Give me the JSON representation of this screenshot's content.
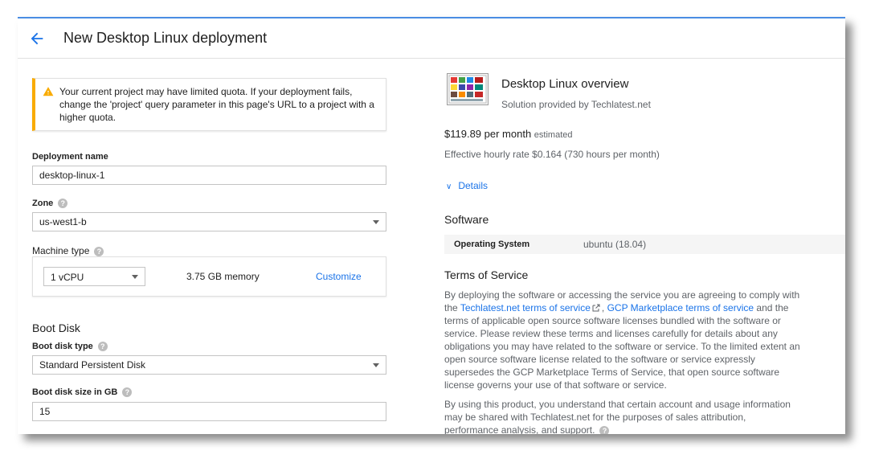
{
  "header": {
    "title": "New Desktop Linux deployment"
  },
  "alert": {
    "message": "Your current project may have limited quota. If your deployment fails, change the 'project' query parameter in this page's URL to a project with a higher quota."
  },
  "form": {
    "deployment_name_label": "Deployment name",
    "deployment_name_value": "desktop-linux-1",
    "zone_label": "Zone",
    "zone_value": "us-west1-b",
    "machine_type_label": "Machine type",
    "vcpu_value": "1 vCPU",
    "memory_text": "3.75 GB memory",
    "customize_label": "Customize",
    "boot_disk_title": "Boot Disk",
    "boot_disk_type_label": "Boot disk type",
    "boot_disk_type_value": "Standard Persistent Disk",
    "boot_disk_size_label": "Boot disk size in GB",
    "boot_disk_size_value": "15",
    "help_glyph": "?"
  },
  "overview": {
    "title": "Desktop Linux overview",
    "provider": "Solution provided by Techlatest.net",
    "price": "$119.89 per month",
    "price_note": "estimated",
    "hourly": "Effective hourly rate $0.164 (730 hours per month)",
    "details_label": "Details",
    "details_chevron": "∨"
  },
  "software": {
    "title": "Software",
    "rows": [
      {
        "key": "Operating System",
        "value": "ubuntu (18.04)"
      }
    ]
  },
  "tos": {
    "title": "Terms of Service",
    "p1_before": "By deploying the software or accessing the service you are agreeing to comply with the ",
    "link1": "Techlatest.net terms of service",
    "p1_sep": ", ",
    "link2": "GCP Marketplace terms of service",
    "p1_after": " and the terms of applicable open source software licenses bundled with the software or service. Please review these terms and licenses carefully for details about any obligations you may have related to the software or service. To the limited extent an open source software license related to the software or service expressly supersedes the GCP Marketplace Terms of Service, that open source software license governs your use of that software or service.",
    "p2": "By using this product, you understand that certain account and usage information may be shared with Techlatest.net for the purposes of sales attribution, performance analysis, and support."
  },
  "colors": {
    "accent": "#1a73e8",
    "warning": "#f9ab00",
    "frame_top": "#4a8de3"
  }
}
